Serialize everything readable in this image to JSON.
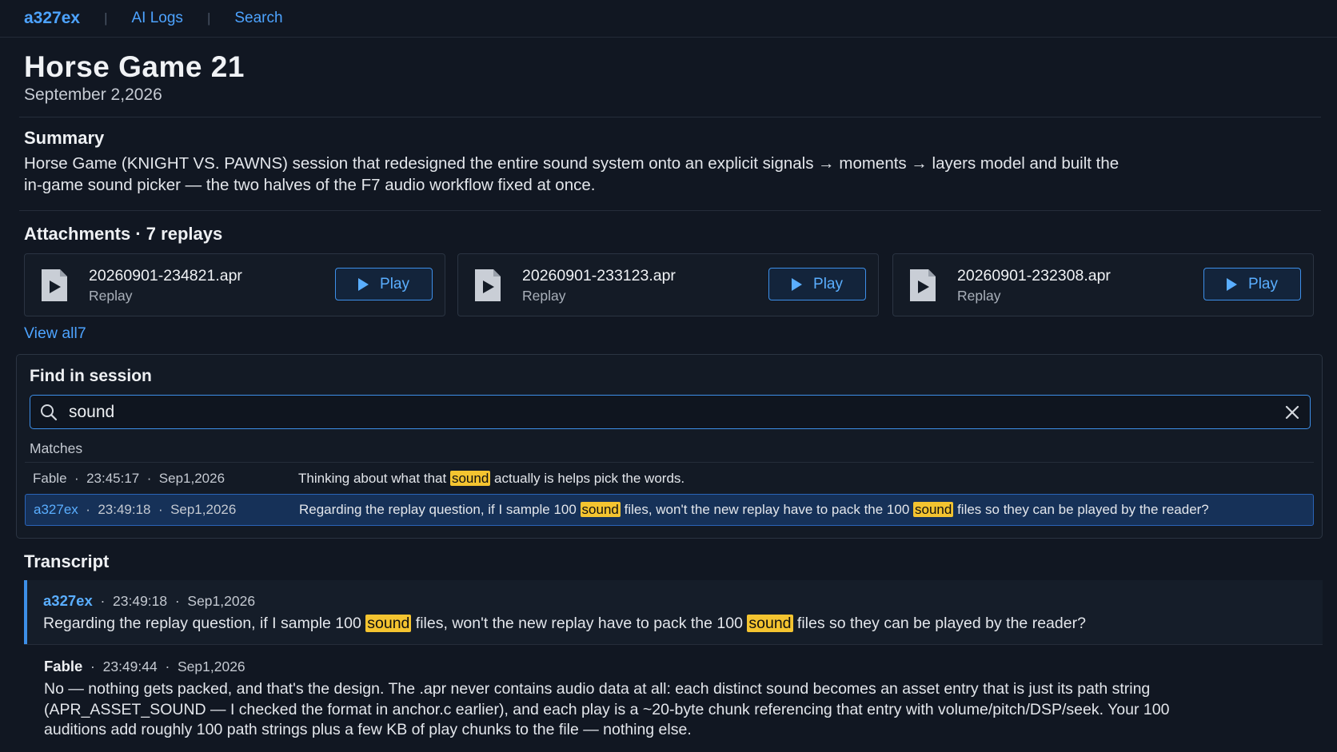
{
  "nav": {
    "brand": "a327ex",
    "sep": "|",
    "links": [
      "AI Logs",
      "Search"
    ]
  },
  "page": {
    "title": "Horse Game 21",
    "date": "September 2,2026"
  },
  "summary": {
    "heading": "Summary",
    "line1": "Horse Game (KNIGHT VS. PAWNS) session that redesigned the entire sound system onto an explicit signals → moments → layers model and built the",
    "line2": "in-game sound picker — the two halves of the F7 audio workflow fixed at once."
  },
  "attachments": {
    "heading": "Attachments · 7 replays",
    "items": [
      {
        "name": "20260901-234821.apr",
        "type": "Replay",
        "play": "Play"
      },
      {
        "name": "20260901-233123.apr",
        "type": "Replay",
        "play": "Play"
      },
      {
        "name": "20260901-232308.apr",
        "type": "Replay",
        "play": "Play"
      }
    ],
    "view_all": "View all7"
  },
  "find": {
    "heading": "Find in session",
    "query": "sound",
    "matches_label": "Matches",
    "matches": [
      {
        "meta": "Fable  ·  23:45:17  ·  Sep1,2026",
        "text_parts": [
          "Thinking about what that ",
          "sound",
          " actually is helps pick the words."
        ]
      },
      {
        "author": "a327ex",
        "meta_rest": "  ·  23:49:18  ·  Sep1,2026",
        "text_parts": [
          "Regarding the replay question, if I sample 100 ",
          "sound",
          " files, won't the new replay have to pack the 100 ",
          "sound",
          " files so they can be played by the reader?"
        ]
      }
    ]
  },
  "transcript": {
    "heading": "Transcript",
    "entries": [
      {
        "author": "a327ex",
        "meta": "  ·  23:49:18  ·  Sep1,2026",
        "text_parts": [
          "Regarding the replay question, if I sample 100 ",
          "sound",
          " files, won't the new replay have to pack the 100 ",
          "sound",
          " files so they can be played by the reader?"
        ]
      },
      {
        "author": "Fable",
        "meta": "  ·  23:49:44  ·  Sep1,2026",
        "line1": "No — nothing gets packed, and that's the design. The .apr never contains audio data at all: each distinct sound becomes an asset entry that is just its path string",
        "line2": "(APR_ASSET_SOUND — I checked the format in anchor.c earlier), and each play is a ~20-byte chunk referencing that entry with volume/pitch/DSP/seek. Your 100",
        "line3": "auditions add roughly 100 path strings plus a few KB of play chunks to the file — nothing else."
      }
    ]
  },
  "colors": {
    "accent": "#4da3ff",
    "highlight": "#f4c430",
    "background": "#111722"
  }
}
